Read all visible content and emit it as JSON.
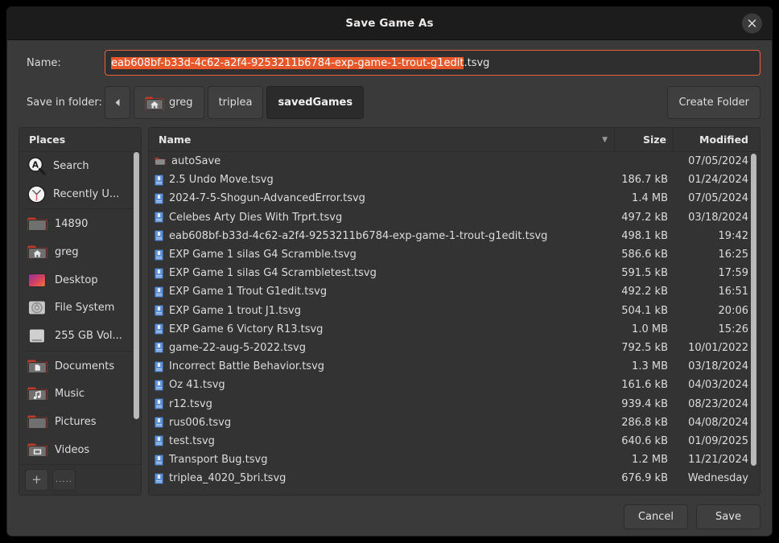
{
  "window": {
    "title": "Save Game As",
    "close_icon": "close-icon"
  },
  "name_field": {
    "label": "Name:",
    "selected_text": "eab608bf-b33d-4c62-a2f4-9253211b6784-exp-game-1-trout-g1edit",
    "trailing_text": ".tsvg",
    "full_value": "eab608bf-b33d-4c62-a2f4-9253211b6784-exp-game-1-trout-g1edit.tsvg",
    "focus_color": "#e8633a",
    "selection_color": "#e8572a"
  },
  "folder_bar": {
    "label": "Save in folder:",
    "back_icon": "chevron-left-icon",
    "crumbs": [
      {
        "label": "greg",
        "icon": "home-folder-icon",
        "active": false
      },
      {
        "label": "triplea",
        "icon": "",
        "active": false
      },
      {
        "label": "savedGames",
        "icon": "",
        "active": true
      }
    ],
    "create_folder_label": "Create Folder"
  },
  "places": {
    "header": "Places",
    "items": [
      {
        "label": "Search",
        "icon": "search-icon"
      },
      {
        "label": "Recently U...",
        "icon": "clock-icon"
      },
      {
        "label": "14890",
        "icon": "folder-icon"
      },
      {
        "label": "greg",
        "icon": "home-folder-icon"
      },
      {
        "label": "Desktop",
        "icon": "desktop-icon"
      },
      {
        "label": "File System",
        "icon": "disc-icon"
      },
      {
        "label": "255 GB Vol...",
        "icon": "drive-icon"
      },
      {
        "label": "Documents",
        "icon": "documents-folder-icon"
      },
      {
        "label": "Music",
        "icon": "music-folder-icon"
      },
      {
        "label": "Pictures",
        "icon": "folder-icon"
      },
      {
        "label": "Videos",
        "icon": "videos-folder-icon"
      }
    ],
    "add_button": "+",
    "remove_button": "....."
  },
  "file_list": {
    "columns": {
      "name": "Name",
      "size": "Size",
      "modified": "Modified",
      "sort_indicator": "▼"
    },
    "rows": [
      {
        "name": "autoSave",
        "size": "",
        "modified": "07/05/2024",
        "icon": "folder-icon"
      },
      {
        "name": "2.5 Undo Move.tsvg",
        "size": "186.7 kB",
        "modified": "01/24/2024",
        "icon": "file-icon"
      },
      {
        "name": "2024-7-5-Shogun-AdvancedError.tsvg",
        "size": "1.4 MB",
        "modified": "07/05/2024",
        "icon": "file-icon"
      },
      {
        "name": "Celebes Arty Dies With Trprt.tsvg",
        "size": "497.2 kB",
        "modified": "03/18/2024",
        "icon": "file-icon"
      },
      {
        "name": "eab608bf-b33d-4c62-a2f4-9253211b6784-exp-game-1-trout-g1edit.tsvg",
        "size": "498.1 kB",
        "modified": "19:42",
        "icon": "file-icon"
      },
      {
        "name": "EXP Game 1 silas G4 Scramble.tsvg",
        "size": "586.6 kB",
        "modified": "16:25",
        "icon": "file-icon"
      },
      {
        "name": "EXP Game 1 silas G4 Scrambletest.tsvg",
        "size": "591.5 kB",
        "modified": "17:59",
        "icon": "file-icon"
      },
      {
        "name": "EXP Game 1 Trout G1edit.tsvg",
        "size": "492.2 kB",
        "modified": "16:51",
        "icon": "file-icon"
      },
      {
        "name": "EXP Game 1 trout J1.tsvg",
        "size": "504.1 kB",
        "modified": "20:06",
        "icon": "file-icon"
      },
      {
        "name": "EXP Game 6 Victory R13.tsvg",
        "size": "1.0 MB",
        "modified": "15:26",
        "icon": "file-icon"
      },
      {
        "name": "game-22-aug-5-2022.tsvg",
        "size": "792.5 kB",
        "modified": "10/01/2022",
        "icon": "file-icon"
      },
      {
        "name": "Incorrect Battle Behavior.tsvg",
        "size": "1.3 MB",
        "modified": "03/18/2024",
        "icon": "file-icon"
      },
      {
        "name": "Oz 41.tsvg",
        "size": "161.6 kB",
        "modified": "04/03/2024",
        "icon": "file-icon"
      },
      {
        "name": "r12.tsvg",
        "size": "939.4 kB",
        "modified": "08/23/2024",
        "icon": "file-icon"
      },
      {
        "name": "rus006.tsvg",
        "size": "286.8 kB",
        "modified": "04/08/2024",
        "icon": "file-icon"
      },
      {
        "name": "test.tsvg",
        "size": "640.6 kB",
        "modified": "01/09/2025",
        "icon": "file-icon"
      },
      {
        "name": "Transport Bug.tsvg",
        "size": "1.2 MB",
        "modified": "11/21/2024",
        "icon": "file-icon"
      },
      {
        "name": "triplea_4020_5bri.tsvg",
        "size": "676.9 kB",
        "modified": "Wednesday",
        "icon": "file-icon"
      }
    ]
  },
  "footer": {
    "cancel_label": "Cancel",
    "save_label": "Save"
  }
}
